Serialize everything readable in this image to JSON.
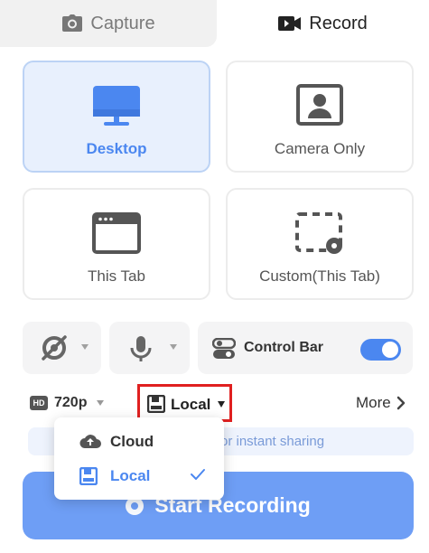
{
  "tabs": {
    "capture_label": "Capture",
    "record_label": "Record",
    "active": "Record"
  },
  "modes": {
    "desktop": "Desktop",
    "camera_only": "Camera Only",
    "this_tab": "This Tab",
    "custom": "Custom(This Tab)",
    "selected": "Desktop"
  },
  "controls": {
    "camera_icon": "camera-off-icon",
    "mic_icon": "microphone-icon",
    "control_bar_label": "Control Bar",
    "control_bar_enabled": true
  },
  "settings": {
    "resolution_badge": "HD",
    "resolution": "720p",
    "storage": "Local",
    "more_label": "More"
  },
  "info": {
    "text": "or instant sharing"
  },
  "start": {
    "label": "Start Recording"
  },
  "storage_dropdown": {
    "options": [
      {
        "label": "Cloud",
        "icon": "cloud-upload-icon",
        "selected": false
      },
      {
        "label": "Local",
        "icon": "disk-icon",
        "selected": true
      }
    ]
  },
  "colors": {
    "accent": "#4b87f0",
    "start_button": "#6e9ef5",
    "selected_card_bg": "#e8f0fd",
    "highlight_border": "#e02020"
  }
}
